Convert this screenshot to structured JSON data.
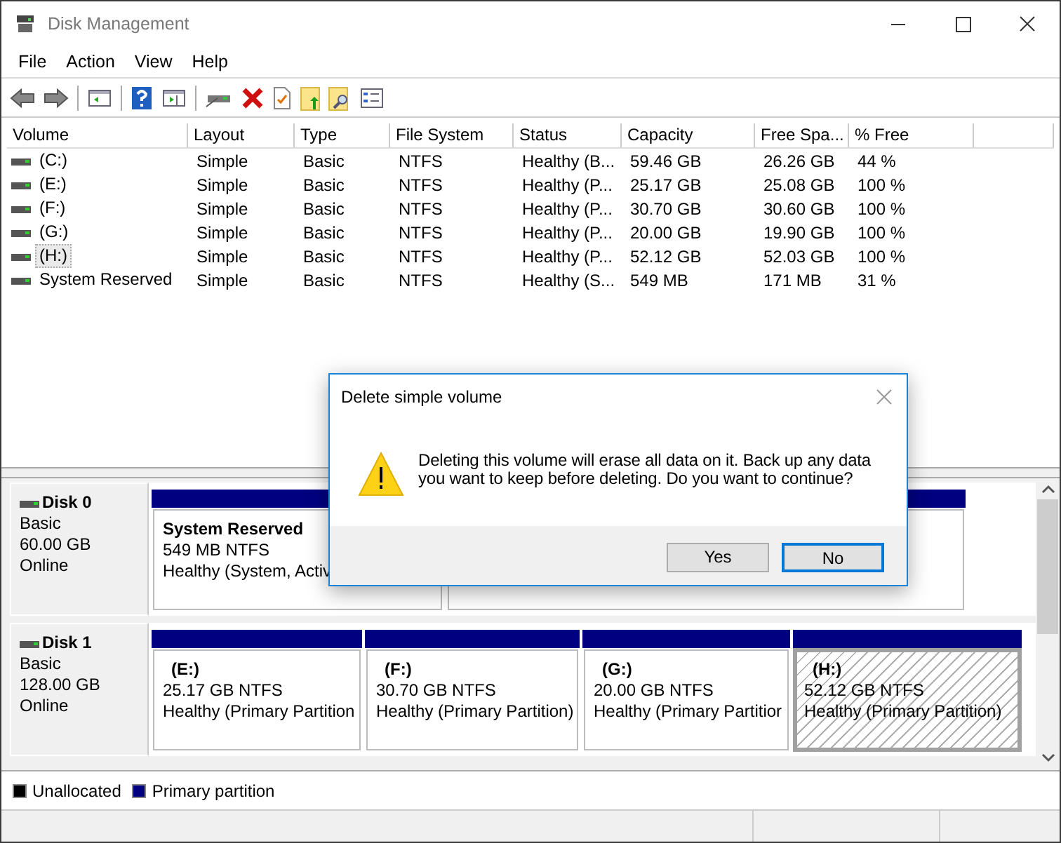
{
  "window": {
    "title": "Disk Management"
  },
  "menu": [
    "File",
    "Action",
    "View",
    "Help"
  ],
  "table": {
    "columns": [
      "Volume",
      "Layout",
      "Type",
      "File System",
      "Status",
      "Capacity",
      "Free Spa...",
      "% Free"
    ],
    "rows": [
      {
        "cells": [
          "(C:)",
          "Simple",
          "Basic",
          "NTFS",
          "Healthy (B...",
          "59.46 GB",
          "26.26 GB",
          "44 %"
        ],
        "selected": false
      },
      {
        "cells": [
          "(E:)",
          "Simple",
          "Basic",
          "NTFS",
          "Healthy (P...",
          "25.17 GB",
          "25.08 GB",
          "100 %"
        ],
        "selected": false
      },
      {
        "cells": [
          "(F:)",
          "Simple",
          "Basic",
          "NTFS",
          "Healthy (P...",
          "30.70 GB",
          "30.60 GB",
          "100 %"
        ],
        "selected": false
      },
      {
        "cells": [
          "(G:)",
          "Simple",
          "Basic",
          "NTFS",
          "Healthy (P...",
          "20.00 GB",
          "19.90 GB",
          "100 %"
        ],
        "selected": false
      },
      {
        "cells": [
          "(H:)",
          "Simple",
          "Basic",
          "NTFS",
          "Healthy (P...",
          "52.12 GB",
          "52.03 GB",
          "100 %"
        ],
        "selected": true
      },
      {
        "cells": [
          "System Reserved",
          "Simple",
          "Basic",
          "NTFS",
          "Healthy (S...",
          "549 MB",
          "171 MB",
          "31 %"
        ],
        "selected": false
      }
    ]
  },
  "disks": [
    {
      "name": "Disk 0",
      "type": "Basic",
      "size": "60.00 GB",
      "status": "Online",
      "partitions": [
        {
          "name": "System Reserved",
          "size": "549 MB NTFS",
          "status": "Healthy (System, Activ",
          "selected": false
        },
        {
          "selected": false
        }
      ]
    },
    {
      "name": "Disk 1",
      "type": "Basic",
      "size": "128.00 GB",
      "status": "Online",
      "partitions": [
        {
          "name": "(E:)",
          "size": "25.17 GB NTFS",
          "status": "Healthy (Primary Partition",
          "selected": false
        },
        {
          "name": "(F:)",
          "size": "30.70 GB NTFS",
          "status": "Healthy (Primary Partition)",
          "selected": false
        },
        {
          "name": "(G:)",
          "size": "20.00 GB NTFS",
          "status": "Healthy (Primary Partitior",
          "selected": false
        },
        {
          "name": "(H:)",
          "size": "52.12 GB NTFS",
          "status": "Healthy (Primary Partition)",
          "selected": true
        }
      ]
    }
  ],
  "legend": [
    {
      "label": "Unallocated",
      "color": "#000000"
    },
    {
      "label": "Primary partition",
      "color": "#000080"
    }
  ],
  "dialog": {
    "title": "Delete simple volume",
    "message": "Deleting this volume will erase all data on it. Back up any data you want to keep before deleting. Do you want to continue?",
    "buttons": [
      {
        "label": "Yes",
        "default": false
      },
      {
        "label": "No",
        "default": true
      }
    ]
  }
}
